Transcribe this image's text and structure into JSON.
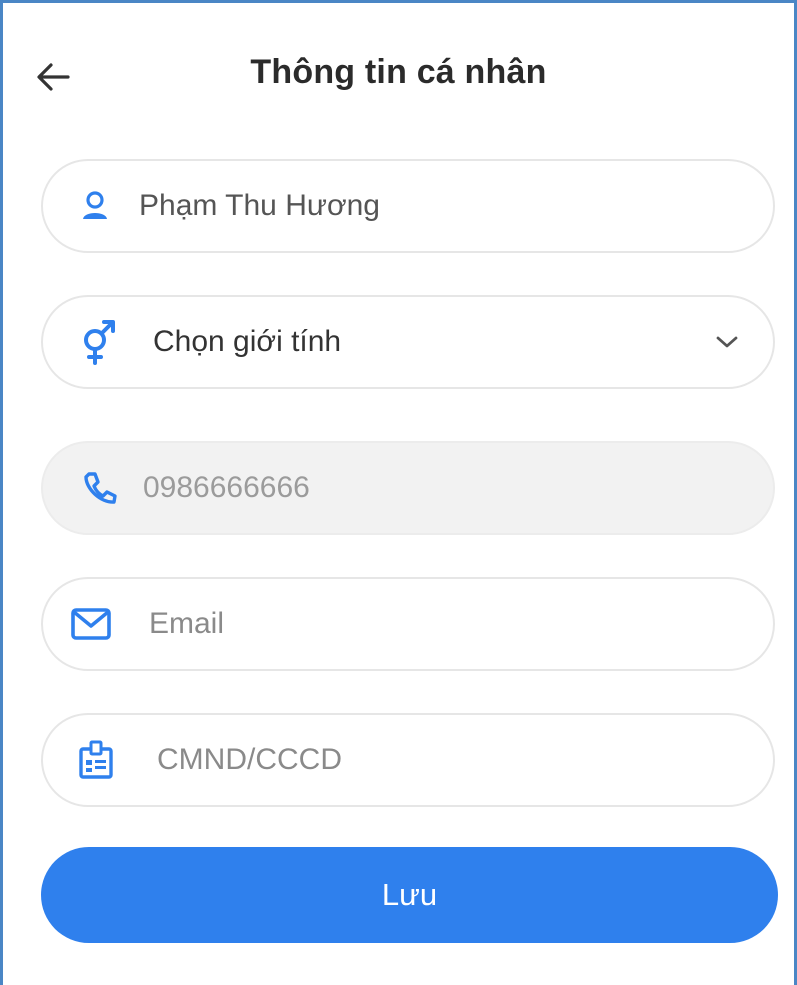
{
  "header": {
    "title": "Thông tin cá nhân"
  },
  "form": {
    "name": {
      "value": "Phạm Thu Hương",
      "icon": "person-icon"
    },
    "gender": {
      "selected": "Chọn giới tính",
      "icon": "gender-icon"
    },
    "phone": {
      "value": "0986666666",
      "icon": "phone-icon",
      "disabled": true
    },
    "email": {
      "placeholder": "Email",
      "icon": "mail-icon"
    },
    "id_card": {
      "placeholder": "CMND/CCCD",
      "icon": "id-card-icon"
    }
  },
  "actions": {
    "save_label": "Lưu"
  },
  "colors": {
    "accent": "#2f80ed",
    "icon": "#2f80ed",
    "border": "#e6e6e6",
    "disabled_bg": "#f2f2f2"
  }
}
